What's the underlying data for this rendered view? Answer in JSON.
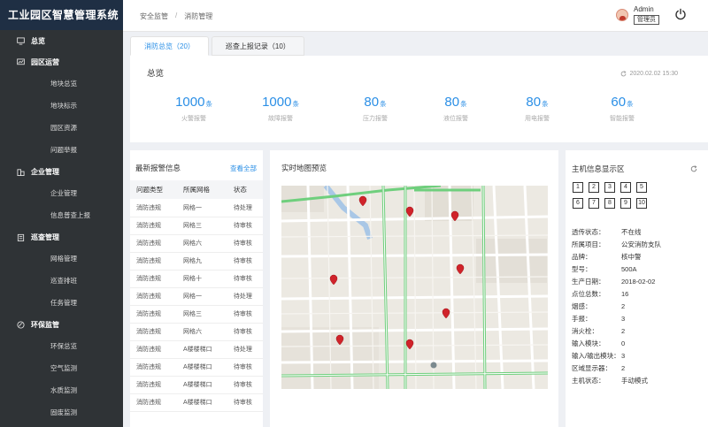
{
  "app": {
    "title": "工业园区智慧管理系统"
  },
  "sidebar": {
    "groups": [
      {
        "label": "总览",
        "icon": "monitor-icon",
        "items": []
      },
      {
        "label": "园区运营",
        "icon": "chart-monitor-icon",
        "items": [
          "地块总览",
          "地块标示",
          "园区资源",
          "问题举报"
        ]
      },
      {
        "label": "企业管理",
        "icon": "building-icon",
        "items": [
          "企业管理",
          "信息普查上报"
        ]
      },
      {
        "label": "巡查管理",
        "icon": "clipboard-icon",
        "items": [
          "网格管理",
          "巡查排班",
          "任务管理"
        ]
      },
      {
        "label": "环保监管",
        "icon": "leaf-icon",
        "items": [
          "环保总览",
          "空气监测",
          "水质监测",
          "固废监测"
        ]
      }
    ]
  },
  "breadcrumb": {
    "first": "安全监管",
    "separator": "/",
    "second": "消防管理"
  },
  "user": {
    "name": "Admin",
    "role": "管理员"
  },
  "tabs": [
    {
      "label": "消防总览（20）",
      "active": true
    },
    {
      "label": "巡查上报记录（10）",
      "active": false
    }
  ],
  "overview": {
    "title": "总览",
    "timestamp": "2020.02.02 15:30",
    "stats": [
      {
        "value": "1000",
        "unit": "条",
        "label": "火警报警"
      },
      {
        "value": "1000",
        "unit": "条",
        "label": "故障报警"
      },
      {
        "value": "80",
        "unit": "条",
        "label": "压力报警"
      },
      {
        "value": "80",
        "unit": "条",
        "label": "液位报警"
      },
      {
        "value": "80",
        "unit": "条",
        "label": "用电报警"
      },
      {
        "value": "60",
        "unit": "条",
        "label": "智能报警"
      }
    ]
  },
  "alerts": {
    "title": "最新报警信息",
    "more": "查看全部",
    "columns": [
      "问题类型",
      "所属网格",
      "状态"
    ],
    "rows": [
      [
        "消防违规",
        "网格一",
        "待处理"
      ],
      [
        "消防违规",
        "网格三",
        "待审核"
      ],
      [
        "消防违规",
        "网格六",
        "待审核"
      ],
      [
        "消防违规",
        "网格九",
        "待审核"
      ],
      [
        "消防违规",
        "网格十",
        "待审核"
      ],
      [
        "消防违规",
        "网格一",
        "待处理"
      ],
      [
        "消防违规",
        "网格三",
        "待审核"
      ],
      [
        "消防违规",
        "网格六",
        "待审核"
      ],
      [
        "消防违规",
        "A楼楼梯口",
        "待处理"
      ],
      [
        "消防违规",
        "A楼楼梯口",
        "待审核"
      ],
      [
        "消防违规",
        "A楼楼梯口",
        "待审核"
      ],
      [
        "消防违规",
        "A楼楼梯口",
        "待审核"
      ]
    ]
  },
  "map": {
    "title": "实时地图预览"
  },
  "host": {
    "title": "主机信息显示区",
    "boxes_row1": [
      "1",
      "2",
      "3",
      "4",
      "5"
    ],
    "boxes_row2": [
      "6",
      "7",
      "8",
      "9",
      "10"
    ],
    "info": [
      {
        "k": "透传状态：",
        "v": "不在线"
      },
      {
        "k": "所属项目：",
        "v": "公安消防支队"
      },
      {
        "k": "品牌：",
        "v": "核中警"
      },
      {
        "k": "型号：",
        "v": "500A"
      },
      {
        "k": "生产日期：",
        "v": "2018-02-02"
      },
      {
        "k": "点位总数：",
        "v": "16"
      },
      {
        "k": "烟感：",
        "v": "2"
      },
      {
        "k": "手报：",
        "v": "3"
      },
      {
        "k": "消火栓：",
        "v": "2"
      },
      {
        "k": "输入模块：",
        "v": "0"
      },
      {
        "k": "输入/输出模块：",
        "v": "3"
      },
      {
        "k": "区域显示器：",
        "v": "2"
      },
      {
        "k": "主机状态：",
        "v": "手动模式"
      }
    ]
  }
}
